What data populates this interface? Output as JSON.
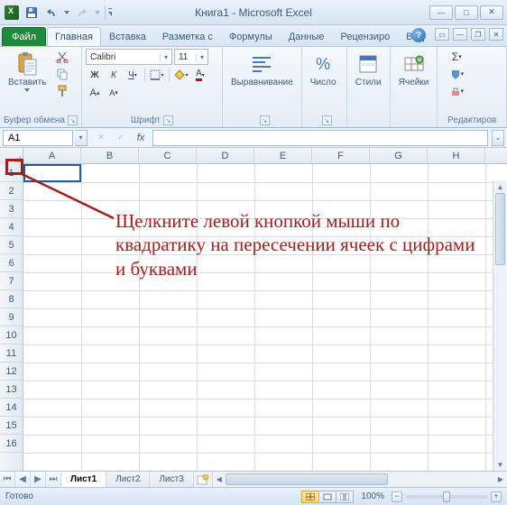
{
  "title": "Книга1 - Microsoft Excel",
  "tabs": {
    "file": "Файл",
    "items": [
      "Главная",
      "Вставка",
      "Разметка с",
      "Формулы",
      "Данные",
      "Рецензиро",
      "Вид"
    ],
    "active": 0
  },
  "ribbon": {
    "clipboard": {
      "paste": "Вставить",
      "label": "Буфер обмена"
    },
    "font": {
      "label": "Шрифт",
      "name": "Calibri",
      "size": "11"
    },
    "alignment": {
      "label": "Выравнивание"
    },
    "number": {
      "label": "Число"
    },
    "styles": {
      "label": "Стили"
    },
    "cells": {
      "label": "Ячейки"
    },
    "editing": {
      "label": "Редактиров"
    }
  },
  "name_box": "A1",
  "fx_label": "fx",
  "columns": [
    "A",
    "B",
    "C",
    "D",
    "E",
    "F",
    "G",
    "H"
  ],
  "rows": [
    "1",
    "2",
    "3",
    "4",
    "5",
    "6",
    "7",
    "8",
    "9",
    "10",
    "11",
    "12",
    "13",
    "14",
    "15",
    "16"
  ],
  "sheets": {
    "items": [
      "Лист1",
      "Лист2",
      "Лист3"
    ],
    "active": 0
  },
  "status": {
    "ready": "Готово",
    "zoom": "100%"
  },
  "annotation": "Щелкните левой кнопкой мыши по квадратику на пересечении ячеек с цифрами и буквами"
}
